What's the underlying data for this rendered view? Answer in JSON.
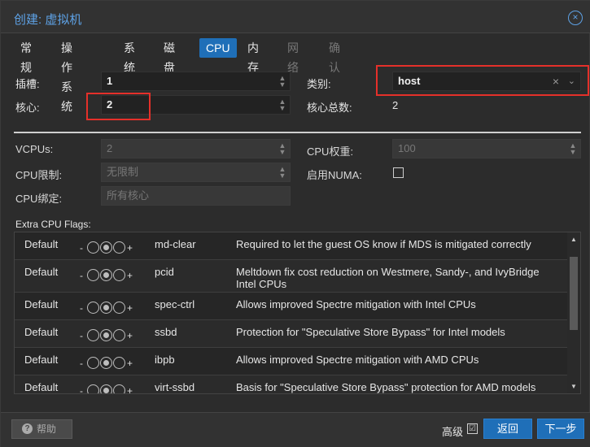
{
  "dialog": {
    "title": "创建: 虚拟机",
    "close_icon": "×"
  },
  "tabs": [
    {
      "label": "常规",
      "state": "normal"
    },
    {
      "label": "操作系统",
      "state": "normal"
    },
    {
      "label": "系统",
      "state": "normal"
    },
    {
      "label": "磁盘",
      "state": "normal"
    },
    {
      "label": "CPU",
      "state": "active"
    },
    {
      "label": "内存",
      "state": "normal"
    },
    {
      "label": "网络",
      "state": "disabled"
    },
    {
      "label": "确认",
      "state": "disabled"
    }
  ],
  "form": {
    "sockets_label": "插槽:",
    "sockets_value": "1",
    "cores_label": "核心:",
    "cores_value": "2",
    "type_label": "类别:",
    "type_value": "host",
    "total_cores_label": "核心总数:",
    "total_cores_value": "2",
    "vcpus_label": "VCPUs:",
    "vcpus_value": "2",
    "cpu_weight_label": "CPU权重:",
    "cpu_weight_value": "100",
    "cpu_limit_label": "CPU限制:",
    "cpu_limit_value": "无限制",
    "numa_label": "启用NUMA:",
    "cpu_affinity_label": "CPU绑定:",
    "cpu_affinity_value": "所有核心"
  },
  "flags": {
    "heading": "Extra CPU Flags:",
    "minus": "-",
    "plus": "+",
    "rows": [
      {
        "state": "Default",
        "name": "md-clear",
        "desc": "Required to let the guest OS know if MDS is mitigated correctly"
      },
      {
        "state": "Default",
        "name": "pcid",
        "desc": "Meltdown fix cost reduction on Westmere, Sandy-, and IvyBridge Intel CPUs"
      },
      {
        "state": "Default",
        "name": "spec-ctrl",
        "desc": "Allows improved Spectre mitigation with Intel CPUs"
      },
      {
        "state": "Default",
        "name": "ssbd",
        "desc": "Protection for \"Speculative Store Bypass\" for Intel models"
      },
      {
        "state": "Default",
        "name": "ibpb",
        "desc": "Allows improved Spectre mitigation with AMD CPUs"
      },
      {
        "state": "Default",
        "name": "virt-ssbd",
        "desc": "Basis for \"Speculative Store Bypass\" protection for AMD models"
      }
    ]
  },
  "footer": {
    "help_label": "帮助",
    "help_icon": "?",
    "advanced_label": "高级",
    "advanced_check": "☑",
    "back_label": "返回",
    "next_label": "下一步"
  },
  "icons": {
    "spin_up": "▲",
    "spin_down": "▼",
    "clear": "×",
    "dropdown": "⌄",
    "scroll_up": "▲",
    "scroll_down": "▼"
  },
  "colors": {
    "accent": "#1f6fb8",
    "title": "#5ea2e6",
    "highlight": "#e5302a"
  }
}
